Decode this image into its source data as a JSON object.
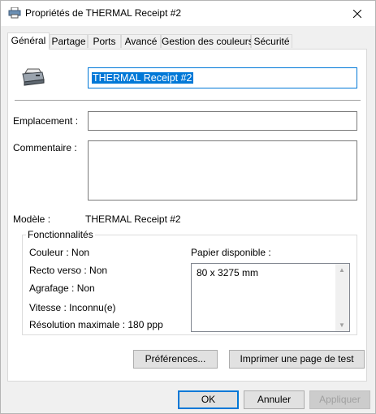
{
  "window": {
    "title": "Propriétés de THERMAL Receipt #2"
  },
  "tabs": [
    {
      "label": "Général"
    },
    {
      "label": "Partage"
    },
    {
      "label": "Ports"
    },
    {
      "label": "Avancé"
    },
    {
      "label": "Gestion des couleurs"
    },
    {
      "label": "Sécurité"
    }
  ],
  "general": {
    "printer_name": "THERMAL Receipt #2",
    "location_label": "Emplacement :",
    "location_value": "",
    "comment_label": "Commentaire :",
    "comment_value": "",
    "model_label": "Modèle :",
    "model_value": "THERMAL Receipt #2",
    "features": {
      "title": "Fonctionnalités",
      "color": "Couleur : Non",
      "duplex": "Recto verso : Non",
      "staple": "Agrafage : Non",
      "speed": "Vitesse : Inconnu(e)",
      "resolution": "Résolution maximale : 180 ppp",
      "paper_label": "Papier disponible :",
      "paper_items": [
        "80 x 3275 mm"
      ]
    },
    "preferences_button": "Préférences...",
    "test_page_button": "Imprimer une page de test"
  },
  "footer": {
    "ok": "OK",
    "cancel": "Annuler",
    "apply": "Appliquer"
  },
  "colors": {
    "accent": "#0078d7",
    "window_bg": "#f0f0f0",
    "panel_bg": "#ffffff"
  }
}
